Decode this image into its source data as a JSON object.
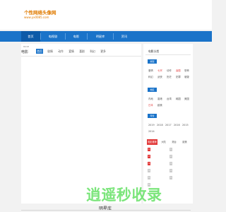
{
  "logo": {
    "title": "个性网络头像网",
    "subtitle": "www.yx0085.com"
  },
  "nav": {
    "items": [
      "首页",
      "电视剧",
      "电影",
      "明星库",
      "资讯"
    ]
  },
  "main": {
    "title": "电影",
    "subtitle": "MOVIE",
    "tabs": [
      "首页",
      "剧情",
      "动作",
      "爱情",
      "喜剧",
      "科幻",
      "更多"
    ]
  },
  "sidebar": {
    "title": "电影分类",
    "sections": [
      {
        "head": "类型",
        "links": [
          "爱情",
          "七宗",
          "动作",
          "喜剧",
          "恐怖",
          "科幻",
          "武侠",
          "历史",
          "犯罪",
          "悬疑"
        ]
      },
      {
        "head": "地区",
        "links": [
          "内地",
          "香港",
          "台湾",
          "韩国",
          "美国",
          "日本",
          "欧美"
        ]
      },
      {
        "head": "年份",
        "links": [
          "2019",
          "2018",
          "2017",
          "2016",
          "2015",
          "2014"
        ]
      }
    ],
    "ranking": {
      "tabs": [
        "电影推荐",
        "大陆",
        "港台",
        "欧美"
      ],
      "numbers": [
        "1",
        "2",
        "3",
        "4",
        "5",
        "6"
      ]
    }
  },
  "footer": {
    "text": "明星库"
  },
  "watermark": {
    "text": "逍遥秒收录"
  },
  "colors": {
    "brand": "#1a73c9",
    "accent": "#e23a3a",
    "logo": "#e07b00",
    "watermark": "#5fe05f"
  }
}
